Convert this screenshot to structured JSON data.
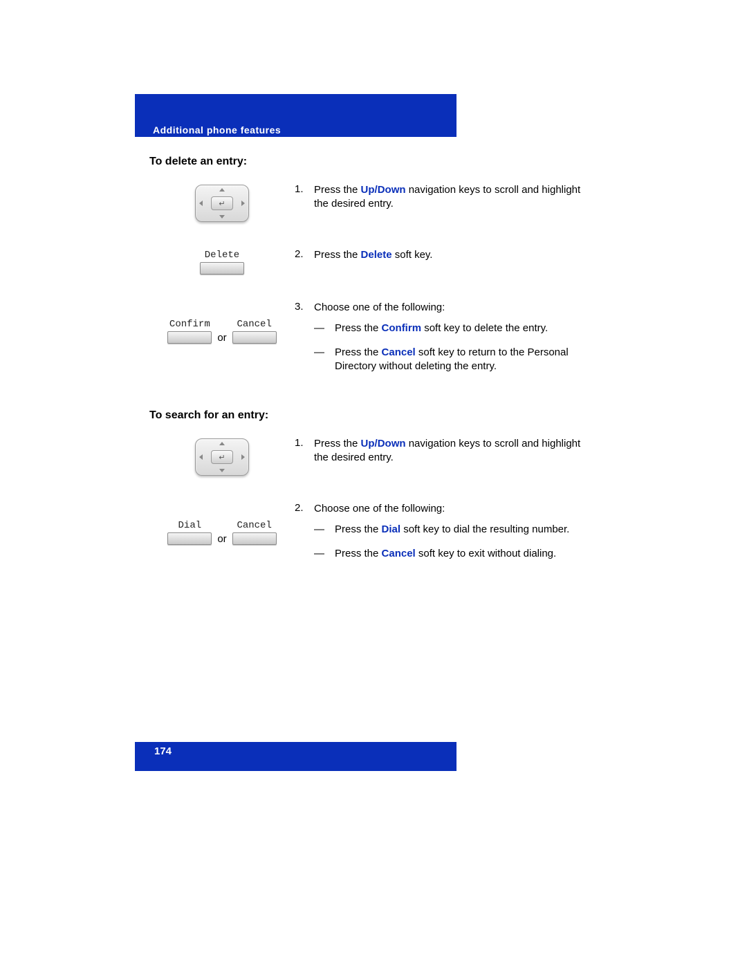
{
  "header": {
    "title": "Additional phone features"
  },
  "footer": {
    "page_number": "174"
  },
  "common": {
    "or": "or",
    "softkeys": {
      "delete": "Delete",
      "confirm": "Confirm",
      "cancel": "Cancel",
      "dial": "Dial"
    }
  },
  "sections": {
    "delete": {
      "heading": "To delete an entry:",
      "steps": [
        {
          "num": "1.",
          "run": [
            {
              "t": "Press the "
            },
            {
              "t": "Up/Down",
              "blue": true
            },
            {
              "t": " navigation keys to scroll and highlight the desired entry."
            }
          ]
        },
        {
          "num": "2.",
          "run": [
            {
              "t": "Press the "
            },
            {
              "t": "Delete",
              "blue": true
            },
            {
              "t": " soft key."
            }
          ]
        },
        {
          "num": "3.",
          "run": [
            {
              "t": "Choose one of the following:"
            }
          ],
          "sub": [
            {
              "run": [
                {
                  "t": "Press the "
                },
                {
                  "t": "Confirm",
                  "blue": true
                },
                {
                  "t": " soft key to delete the entry."
                }
              ]
            },
            {
              "run": [
                {
                  "t": "Press the "
                },
                {
                  "t": "Cancel",
                  "blue": true
                },
                {
                  "t": " soft key to return to the Personal Directory without deleting the entry."
                }
              ]
            }
          ]
        }
      ]
    },
    "search": {
      "heading": "To search for an entry:",
      "steps": [
        {
          "num": "1.",
          "run": [
            {
              "t": "Press the "
            },
            {
              "t": "Up/Down",
              "blue": true
            },
            {
              "t": " navigation keys to scroll and highlight the desired entry."
            }
          ]
        },
        {
          "num": "2.",
          "run": [
            {
              "t": "Choose one of the following:"
            }
          ],
          "sub": [
            {
              "run": [
                {
                  "t": "Press the "
                },
                {
                  "t": "Dial",
                  "blue": true
                },
                {
                  "t": " soft key to dial the resulting number."
                }
              ]
            },
            {
              "run": [
                {
                  "t": "Press the "
                },
                {
                  "t": "Cancel",
                  "blue": true
                },
                {
                  "t": " soft key to exit without dialing."
                }
              ]
            }
          ]
        }
      ]
    }
  }
}
